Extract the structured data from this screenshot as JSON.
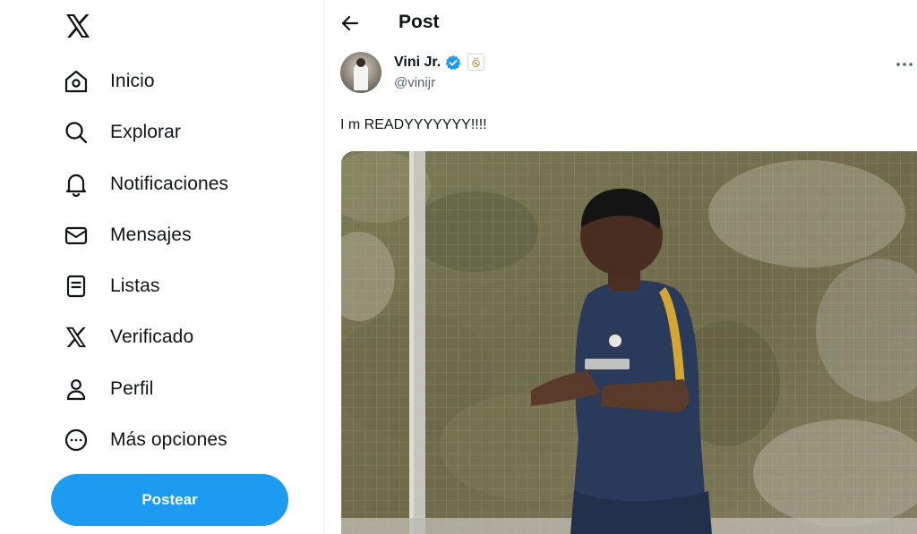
{
  "sidebar": {
    "items": [
      {
        "label": "Inicio",
        "icon": "home-icon"
      },
      {
        "label": "Explorar",
        "icon": "search-icon"
      },
      {
        "label": "Notificaciones",
        "icon": "bell-icon"
      },
      {
        "label": "Mensajes",
        "icon": "envelope-icon"
      },
      {
        "label": "Listas",
        "icon": "list-icon"
      },
      {
        "label": "Verificado",
        "icon": "x-logo-icon"
      },
      {
        "label": "Perfil",
        "icon": "person-icon"
      },
      {
        "label": "Más opciones",
        "icon": "more-circle-icon"
      }
    ],
    "post_button": "Postear"
  },
  "header": {
    "title": "Post"
  },
  "post": {
    "author": {
      "name": "Vini Jr.",
      "handle": "@vinijr"
    },
    "text": "I m READYYYYYYY!!!!"
  },
  "colors": {
    "accent": "#1d9bf0",
    "text": "#0f1419",
    "secondary_text": "#536471",
    "verified": "#1d9bf0"
  }
}
